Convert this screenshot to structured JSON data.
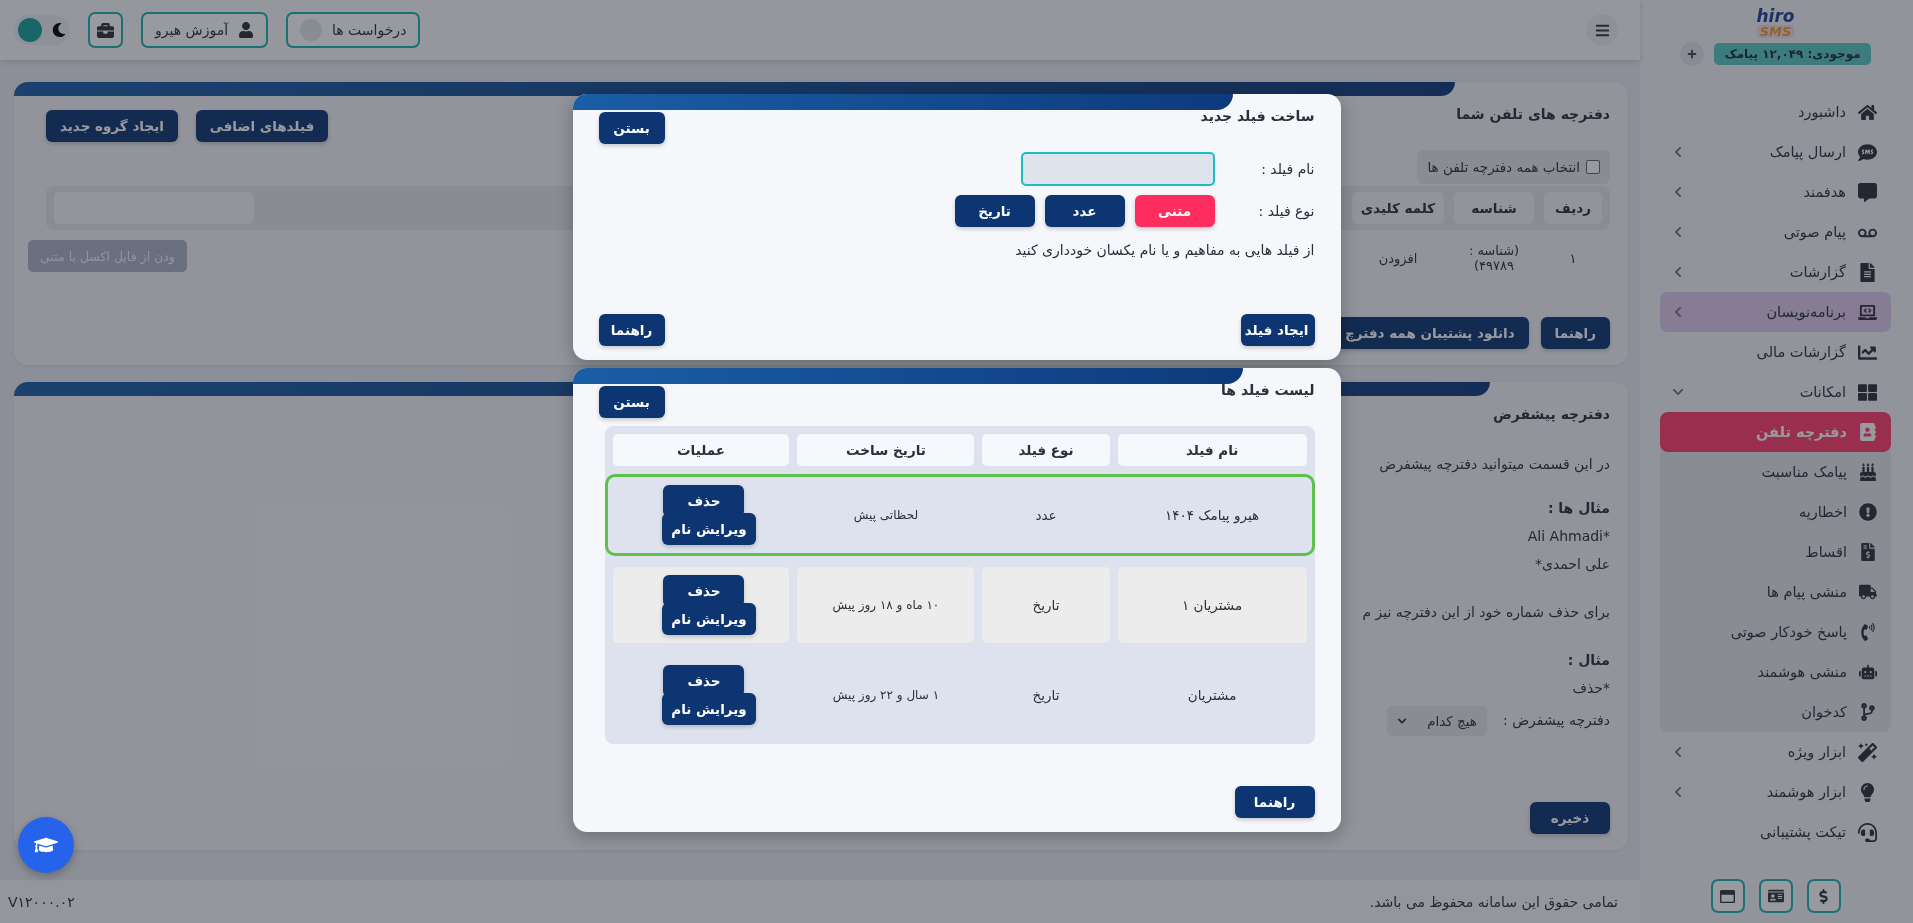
{
  "topbar": {
    "requests_button": "درخواست ها",
    "training_button": "آموزش هیرو",
    "theme_toggle": {
      "on": false
    }
  },
  "sidebar": {
    "logo": {
      "word": "hiro",
      "mark": "SMS"
    },
    "balance": "موجودی: ۱۲,۰۴۹ پیامک",
    "items": [
      {
        "label": "داشبورد",
        "kind": "link",
        "highlighted": false
      },
      {
        "label": "ارسال پیامک",
        "kind": "submenu",
        "highlighted": false,
        "expanded": false
      },
      {
        "label": "هدفمند",
        "kind": "submenu",
        "highlighted": false,
        "expanded": false
      },
      {
        "label": "پیام صوتی",
        "kind": "submenu",
        "highlighted": false,
        "expanded": false
      },
      {
        "label": "گزارشات",
        "kind": "submenu",
        "highlighted": false,
        "expanded": false
      },
      {
        "label": "برنامه‌نویسان",
        "kind": "submenu",
        "highlighted": true,
        "expanded": false
      },
      {
        "label": "گزارشات مالی",
        "kind": "link",
        "highlighted": false
      },
      {
        "label": "امکانات",
        "kind": "submenu",
        "highlighted": false,
        "expanded": true,
        "children": [
          {
            "label": "دفترچه تلفن",
            "selected": true
          },
          {
            "label": "پیامک مناسبت",
            "selected": false
          },
          {
            "label": "اخطاریه",
            "selected": false
          },
          {
            "label": "اقساط",
            "selected": false
          },
          {
            "label": "منشی پیام ها",
            "selected": false
          },
          {
            "label": "پاسخ خودکار صوتی",
            "selected": false
          },
          {
            "label": "منشی هوشمند",
            "selected": false
          },
          {
            "label": "کدخوان",
            "selected": false
          }
        ]
      },
      {
        "label": "ابزار ویژه",
        "kind": "submenu",
        "highlighted": false,
        "expanded": false
      },
      {
        "label": "ابزار هوشمند",
        "kind": "submenu",
        "highlighted": false,
        "expanded": false
      },
      {
        "label": "تیکت پشتیبانی",
        "kind": "link",
        "highlighted": false
      }
    ]
  },
  "phonebooks_card": {
    "title": "دفترچه های تلفن شما",
    "buttons": [
      "فیلدهای اضافی",
      "ایجاد گروه جدید"
    ],
    "select_all": {
      "label": "انتخاب همه دفترچه تلفن ها",
      "checked": false
    },
    "columns": [
      "ردیف",
      "شناسه",
      "کلمه کلیدی"
    ],
    "rows": [
      [
        "۱",
        "(شناسه : ۴۹۷۸۹)",
        "افزودن"
      ]
    ],
    "import_button": {
      "label": "ودن از فایل اکسل یا متنی",
      "disabled": true
    },
    "footer_buttons": [
      "راهنما",
      "دانلود پشتیبان همه دفترچ"
    ]
  },
  "default_card": {
    "title": "دفترچه پیشفرض",
    "intro": "در این قسمت میتوانید دفترچه پیشفرض",
    "examples_heading": "مثال ها :",
    "examples": [
      "*Ali Ahmadi",
      "علی احمدی*"
    ],
    "remove_note": "برای حذف شماره خود از این دفترچه نیز م",
    "example_heading": "مثال :",
    "example": "*حذف",
    "select_label": "دفترچه پیشفرض :",
    "select_value": "هیچ کدام",
    "save_button": "ذخیره"
  },
  "footer": {
    "copyright": "تمامی حقوق این سامانه محفوظ می باشد.",
    "version": "V۱۲۰۰۰.۰۲"
  },
  "create_field_modal": {
    "title": "ساخت فیلد جدید",
    "close_button": "بستن",
    "name_label": "نام فیلد :",
    "name_field": {
      "focused": true
    },
    "type_label": "نوع فیلد :",
    "types": [
      {
        "label": "متنی",
        "selected": true
      },
      {
        "label": "عدد",
        "selected": false
      },
      {
        "label": "تاریخ",
        "selected": false
      }
    ],
    "note": "از فیلد هایی به مفاهیم و یا نام یکسان خودداری کنید",
    "create_button": "ایجاد فیلد",
    "help_button": "راهنما"
  },
  "field_list_modal": {
    "title": "لیست فیلد ها",
    "close_button": "بستن",
    "columns": [
      "نام فیلد",
      "نوع فیلد",
      "تاریخ ساخت",
      "عملیات"
    ],
    "rows": [
      {
        "name": "هیرو پیامک ۱۴۰۴",
        "type": "عدد",
        "created": "لحظاتی پیش",
        "selected": true,
        "actions": [
          "حذف",
          "ویرایش نام"
        ]
      },
      {
        "name": "مشتریان ۱",
        "type": "تاریخ",
        "created": "۱۰ ماه و ۱۸ روز پیش",
        "selected": false,
        "actions": [
          "حذف",
          "ویرایش نام"
        ]
      },
      {
        "name": "مشتریان",
        "type": "تاریخ",
        "created": "۱ سال و ۲۲ روز پیش",
        "selected": false,
        "actions": [
          "حذف",
          "ویرایش نام"
        ]
      }
    ],
    "help_button": "راهنما"
  }
}
